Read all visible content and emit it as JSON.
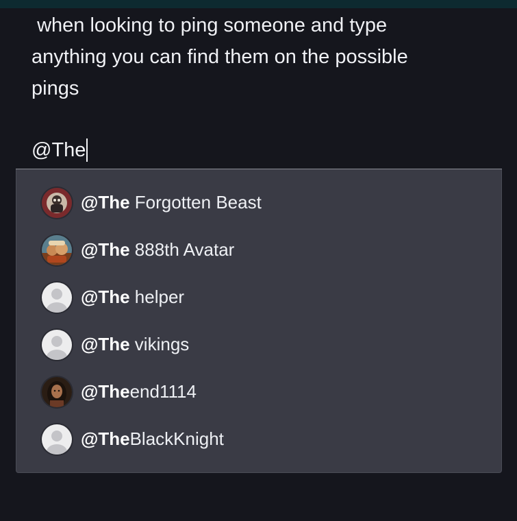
{
  "post": {
    "text": " when looking to ping someone and type\nanything you can find them on the possible\npings"
  },
  "composer": {
    "value": "@The"
  },
  "mention_dropdown": {
    "options": [
      {
        "prefix": "@The",
        "rest": " Forgotten Beast",
        "avatar": "custom-avatar-icon"
      },
      {
        "prefix": "@The",
        "rest": " 888th Avatar",
        "avatar": "custom-avatar-icon"
      },
      {
        "prefix": "@The",
        "rest": " helper",
        "avatar": "default-avatar-icon"
      },
      {
        "prefix": "@The",
        "rest": " vikings",
        "avatar": "default-avatar-icon"
      },
      {
        "prefix": "@The",
        "rest": "end1114",
        "avatar": "custom-avatar-icon"
      },
      {
        "prefix": "@The",
        "rest": "BlackKnight",
        "avatar": "default-avatar-icon"
      }
    ]
  },
  "colors": {
    "background": "#15161d",
    "dropdown": "#3a3b45",
    "text": "#eceef3"
  }
}
